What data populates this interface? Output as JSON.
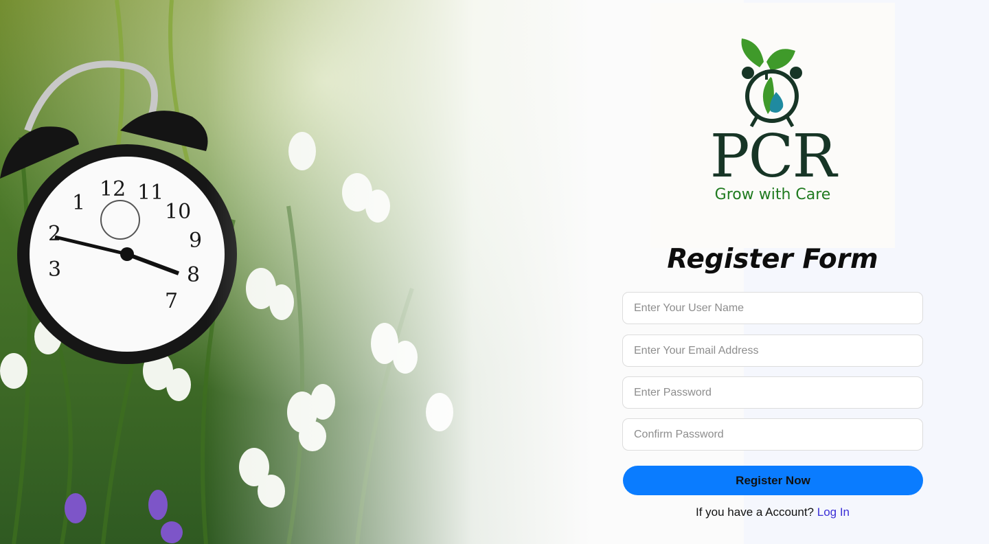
{
  "brand": {
    "name": "PCR",
    "tagline": "Grow with Care",
    "logo_icon": "sprout-alarm-clock-icon",
    "colors": {
      "dark_green": "#173526",
      "leaf_green": "#3f9a2a",
      "water_teal": "#1f8aa0"
    }
  },
  "hero": {
    "image": "alarm-clock-in-flowers-photo"
  },
  "form": {
    "title": "Register Form",
    "fields": {
      "username": {
        "placeholder": "Enter Your User Name",
        "value": ""
      },
      "email": {
        "placeholder": "Enter Your Email Address",
        "value": ""
      },
      "password": {
        "placeholder": "Enter Password",
        "value": ""
      },
      "confirm_password": {
        "placeholder": "Confirm Password",
        "value": ""
      }
    },
    "submit_label": "Register Now",
    "accent_color": "#0a7cff"
  },
  "login_prompt": {
    "text": "If you have a Account?",
    "link_label": "Log In"
  }
}
